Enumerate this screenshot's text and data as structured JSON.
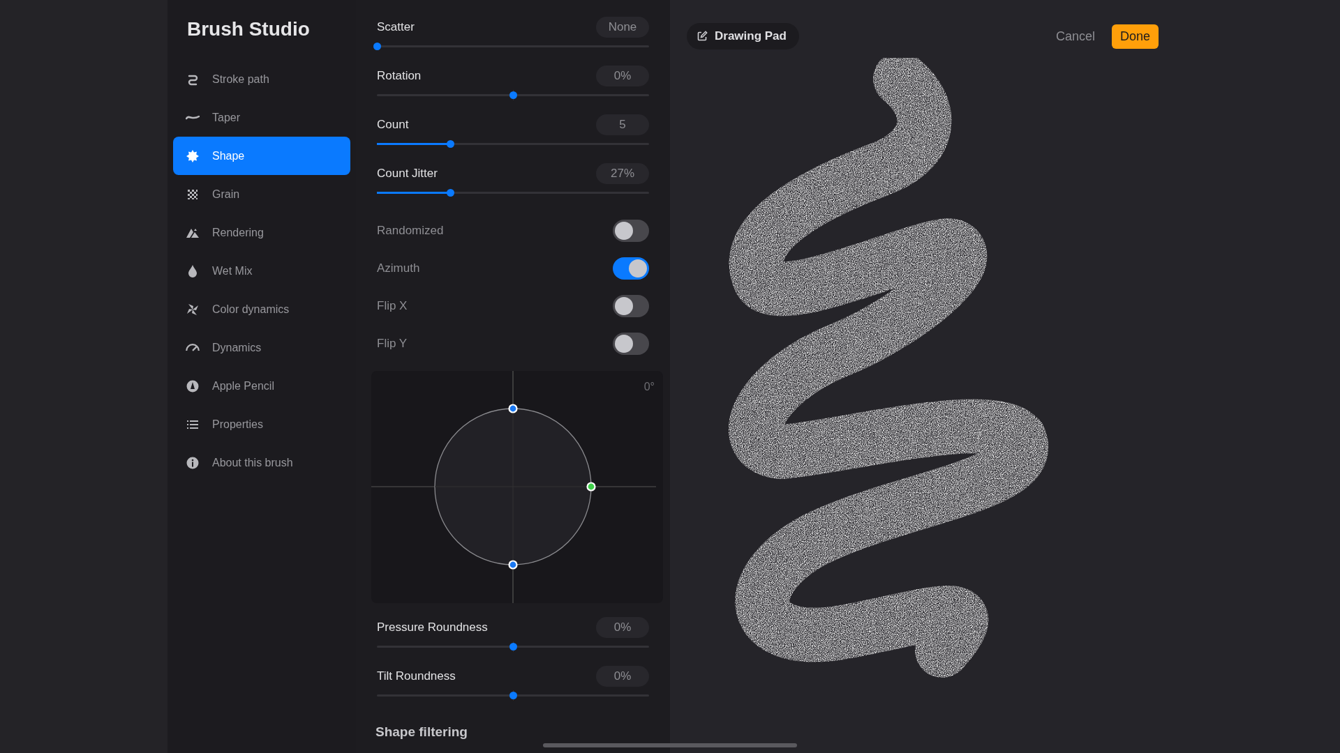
{
  "sidebar": {
    "title": "Brush Studio",
    "items": [
      {
        "label": "Stroke path",
        "selected": false
      },
      {
        "label": "Taper",
        "selected": false
      },
      {
        "label": "Shape",
        "selected": true
      },
      {
        "label": "Grain",
        "selected": false
      },
      {
        "label": "Rendering",
        "selected": false
      },
      {
        "label": "Wet Mix",
        "selected": false
      },
      {
        "label": "Color dynamics",
        "selected": false
      },
      {
        "label": "Dynamics",
        "selected": false
      },
      {
        "label": "Apple Pencil",
        "selected": false
      },
      {
        "label": "Properties",
        "selected": false
      },
      {
        "label": "About this brush",
        "selected": false
      }
    ]
  },
  "controls": [
    {
      "kind": "slider",
      "label": "Scatter",
      "value": "None",
      "level": 0
    },
    {
      "kind": "centered-slider",
      "label": "Rotation",
      "value": "0%",
      "level": 0.5
    },
    {
      "kind": "slider",
      "label": "Count",
      "value": "5",
      "level": 0.27
    },
    {
      "kind": "slider",
      "label": "Count Jitter",
      "value": "27%",
      "level": 0.27
    },
    {
      "kind": "toggle",
      "label": "Randomized",
      "on": false
    },
    {
      "kind": "toggle",
      "label": "Azimuth",
      "on": true
    },
    {
      "kind": "toggle",
      "label": "Flip X",
      "on": false
    },
    {
      "kind": "toggle",
      "label": "Flip Y",
      "on": false
    }
  ],
  "roundness_graph": {
    "angle": "0°"
  },
  "roundness_controls": [
    {
      "kind": "centered-slider",
      "label": "Pressure Roundness",
      "value": "0%",
      "level": 0.5
    },
    {
      "kind": "centered-slider",
      "label": "Tilt Roundness",
      "value": "0%",
      "level": 0.5
    }
  ],
  "section_heading": "Shape filtering",
  "canvas": {
    "title": "Drawing Pad",
    "cancel": "Cancel",
    "done": "Done"
  }
}
